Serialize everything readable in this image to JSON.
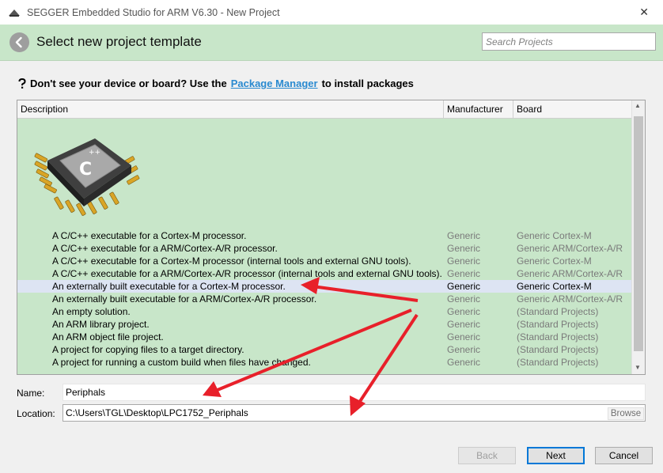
{
  "window": {
    "title": "SEGGER Embedded Studio for ARM V6.30 - New Project",
    "close_glyph": "✕"
  },
  "header": {
    "heading": "Select new project template",
    "search_placeholder": "Search Projects",
    "back_glyph": "◀"
  },
  "hint": {
    "prefix": "Don't see your device or board? Use the",
    "link": "Package Manager",
    "suffix": "to install packages",
    "icon": "help-icon"
  },
  "table": {
    "columns": [
      "Description",
      "Manufacturer",
      "Board"
    ],
    "rows": [
      {
        "description": "A C/C++ executable for a Cortex-M processor.",
        "manufacturer": "Generic",
        "board": "Generic Cortex-M"
      },
      {
        "description": "A C/C++ executable for a ARM/Cortex-A/R processor.",
        "manufacturer": "Generic",
        "board": "Generic ARM/Cortex-A/R"
      },
      {
        "description": "A C/C++ executable for a Cortex-M processor (internal tools and external GNU tools).",
        "manufacturer": "Generic",
        "board": "Generic Cortex-M"
      },
      {
        "description": "A C/C++ executable for a ARM/Cortex-A/R processor (internal tools and external GNU tools).",
        "manufacturer": "Generic",
        "board": "Generic ARM/Cortex-A/R"
      },
      {
        "description": "An externally built executable for a Cortex-M processor.",
        "manufacturer": "Generic",
        "board": "Generic Cortex-M"
      },
      {
        "description": "An externally built executable for a ARM/Cortex-A/R processor.",
        "manufacturer": "Generic",
        "board": "Generic ARM/Cortex-A/R"
      },
      {
        "description": "An empty solution.",
        "manufacturer": "Generic",
        "board": "(Standard Projects)"
      },
      {
        "description": "An ARM library project.",
        "manufacturer": "Generic",
        "board": "(Standard Projects)"
      },
      {
        "description": "An ARM object file project.",
        "manufacturer": "Generic",
        "board": "(Standard Projects)"
      },
      {
        "description": "A project for copying files to a target directory.",
        "manufacturer": "Generic",
        "board": "(Standard Projects)"
      },
      {
        "description": "A project for running a custom build when files have changed.",
        "manufacturer": "Generic",
        "board": "(Standard Projects)"
      }
    ],
    "selected_index": 4,
    "scroll_up_glyph": "▲",
    "scroll_down_glyph": "▼",
    "chip_text": {
      "top": "++",
      "main": "C"
    }
  },
  "form": {
    "name_label": "Name:",
    "name_value": "Periphals",
    "location_label": "Location:",
    "location_value": "C:\\Users\\TGL\\Desktop\\LPC1752_Periphals",
    "browse_label": "Browse"
  },
  "buttons": {
    "back": "Back",
    "next": "Next",
    "cancel": "Cancel"
  },
  "colors": {
    "header_bg": "#c8e6c9",
    "link": "#2a8ad0",
    "selected_row": "#dde4f3",
    "annotation_arrow": "#e8202a"
  }
}
